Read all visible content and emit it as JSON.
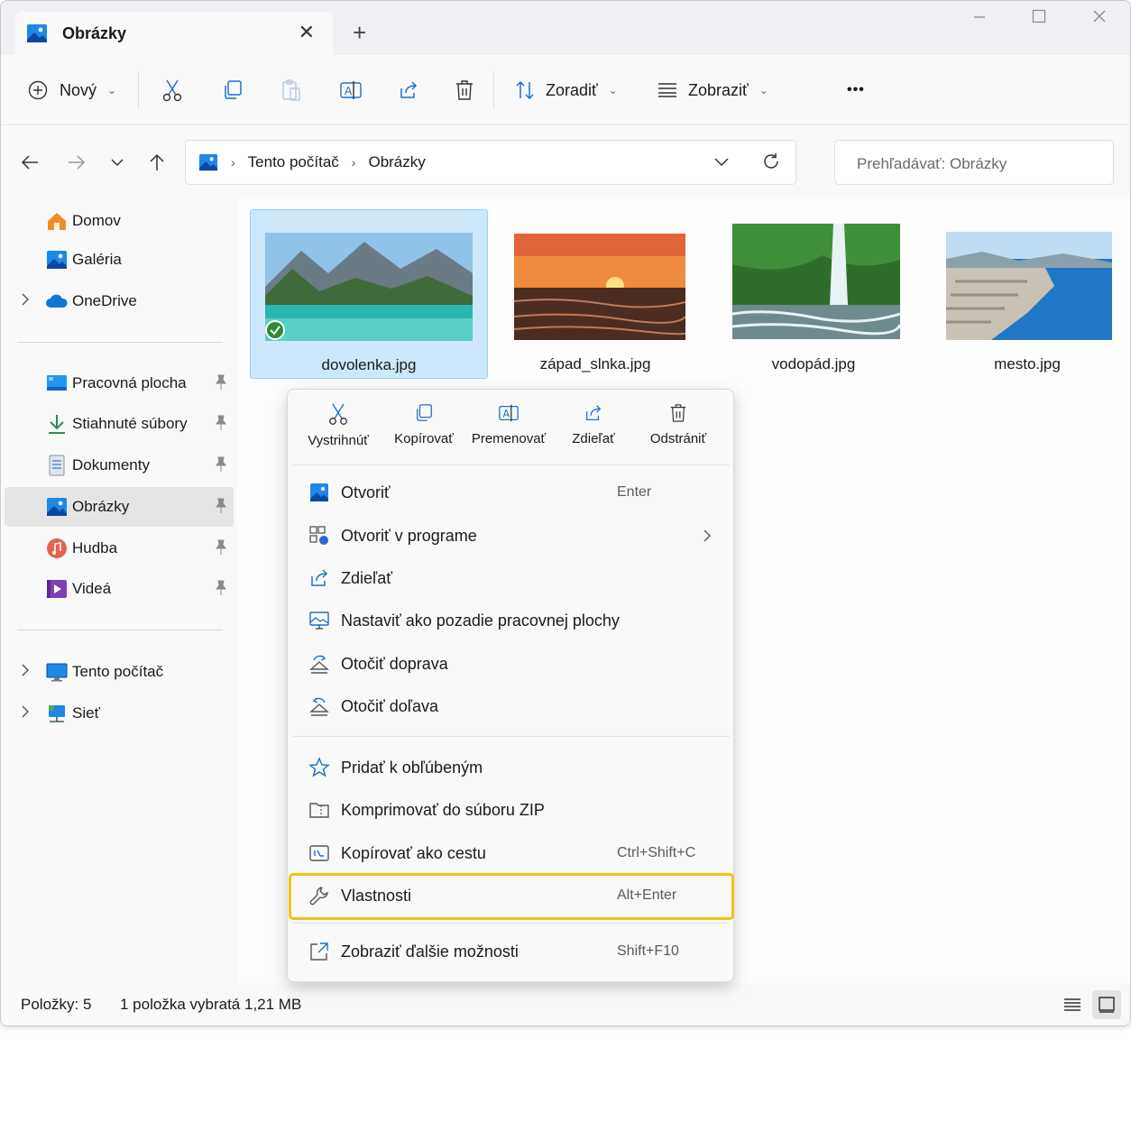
{
  "window": {
    "tab_title": "Obrázky",
    "tab_close": "✕",
    "new_tab": "+"
  },
  "toolbar": {
    "new_label": "Nový",
    "sort_label": "Zoradiť",
    "view_label": "Zobraziť",
    "more_label": "•••"
  },
  "address": {
    "crumbs": [
      "Tento počítač",
      "Obrázky"
    ],
    "search_placeholder": "Prehľadávať: Obrázky"
  },
  "sidebar": {
    "items": [
      {
        "label": "Domov",
        "icon": "home-icon"
      },
      {
        "label": "Galéria",
        "icon": "gallery-icon"
      },
      {
        "label": "OneDrive",
        "icon": "onedrive-icon"
      },
      {
        "label": "Pracovná plocha",
        "icon": "desktop-icon"
      },
      {
        "label": "Stiahnuté súbory",
        "icon": "download-icon"
      },
      {
        "label": "Dokumenty",
        "icon": "documents-icon"
      },
      {
        "label": "Obrázky",
        "icon": "pictures-icon"
      },
      {
        "label": "Hudba",
        "icon": "music-icon"
      },
      {
        "label": "Videá",
        "icon": "videos-icon"
      },
      {
        "label": "Tento počítač",
        "icon": "computer-icon"
      },
      {
        "label": "Sieť",
        "icon": "network-icon"
      }
    ]
  },
  "files": [
    {
      "name": "dovolenka.jpg"
    },
    {
      "name": "západ_slnka.jpg"
    },
    {
      "name": "vodopád.jpg"
    },
    {
      "name": "mesto.jpg"
    }
  ],
  "context_menu": {
    "quick_actions": [
      "Vystrihnúť",
      "Kopírovať",
      "Premenovať",
      "Zdieľať",
      "Odstrániť"
    ],
    "items": [
      {
        "label": "Otvoriť",
        "shortcut": "Enter"
      },
      {
        "label": "Otvoriť v programe",
        "shortcut": ""
      },
      {
        "label": "Zdieľať",
        "shortcut": ""
      },
      {
        "label": "Nastaviť ako pozadie pracovnej plochy",
        "shortcut": ""
      },
      {
        "label": "Otočiť doprava",
        "shortcut": ""
      },
      {
        "label": "Otočiť doľava",
        "shortcut": ""
      },
      {
        "label": "Pridať k obľúbeným",
        "shortcut": ""
      },
      {
        "label": "Komprimovať do súboru ZIP",
        "shortcut": ""
      },
      {
        "label": "Kopírovať ako cestu",
        "shortcut": "Ctrl+Shift+C"
      },
      {
        "label": "Vlastnosti",
        "shortcut": "Alt+Enter"
      },
      {
        "label": "Zobraziť ďalšie možnosti",
        "shortcut": "Shift+F10"
      }
    ]
  },
  "status": {
    "items_count": "Položky: 5",
    "selection": "1 položka vybratá",
    "size": "1,21 MB"
  },
  "colors": {
    "accent": "#0067c0",
    "highlight_box": "#f2c40f",
    "selection_bg": "#cde8fb"
  }
}
